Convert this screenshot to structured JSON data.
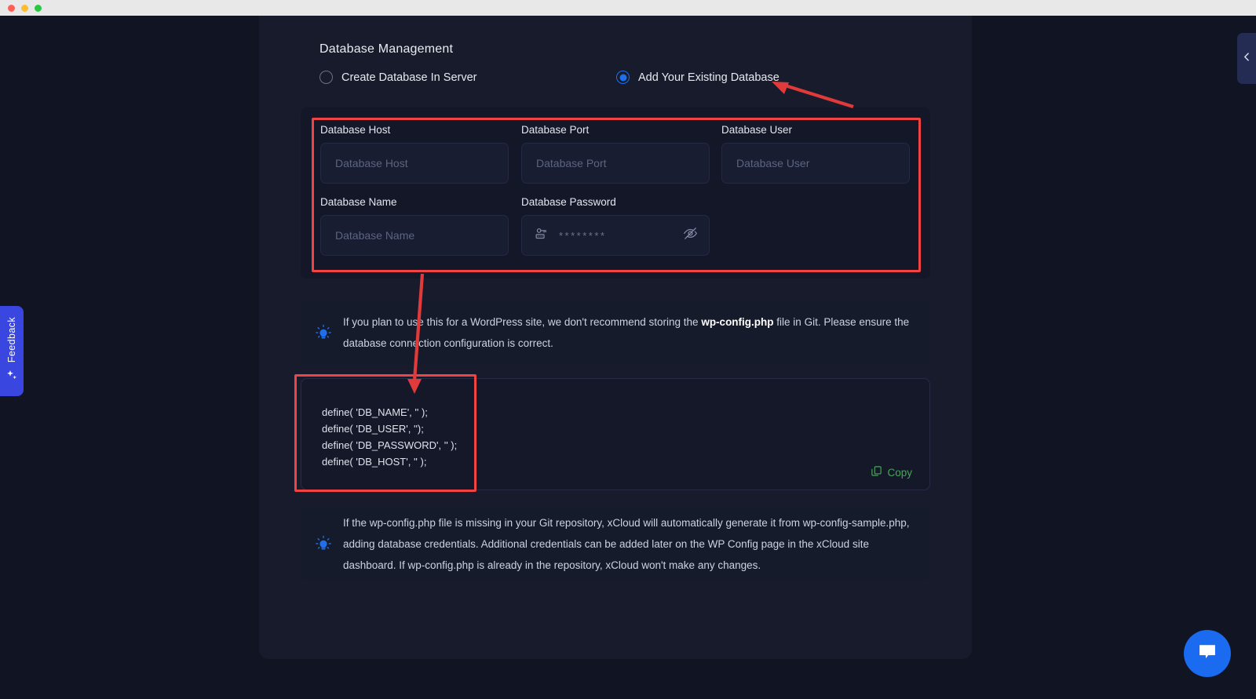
{
  "window": {
    "traffic_lights": [
      "close",
      "minimize",
      "maximize"
    ]
  },
  "section": {
    "title": "Database Management"
  },
  "radios": [
    {
      "id": "create",
      "label": "Create Database In Server",
      "selected": false
    },
    {
      "id": "existing",
      "label": "Add Your Existing Database",
      "selected": true
    }
  ],
  "fields": {
    "host": {
      "label": "Database Host",
      "placeholder": "Database Host",
      "value": ""
    },
    "port": {
      "label": "Database Port",
      "placeholder": "Database Port",
      "value": ""
    },
    "user": {
      "label": "Database User",
      "placeholder": "Database User",
      "value": ""
    },
    "name": {
      "label": "Database Name",
      "placeholder": "Database Name",
      "value": ""
    },
    "password": {
      "label": "Database Password",
      "masked_value": "********",
      "icon": "key-icon",
      "toggle_icon": "eye-off-icon"
    }
  },
  "notes": {
    "top": {
      "icon": "lightbulb-icon",
      "text_before": "If you plan to use this for a WordPress site, we don't recommend storing the ",
      "bold": "wp-config.php",
      "text_after": " file in Git. Please ensure the database connection configuration is correct."
    },
    "bottom": {
      "icon": "lightbulb-icon",
      "text": "If the wp-config.php file is missing in your Git repository, xCloud will automatically generate it from wp-config-sample.php, adding database credentials. Additional credentials can be added later on the WP Config page in the xCloud site dashboard. If wp-config.php is already in the repository, xCloud won't make any changes."
    }
  },
  "code_block": {
    "lines": [
      "define( 'DB_NAME', '' );",
      "define( 'DB_USER', '');",
      "define( 'DB_PASSWORD', '' );",
      "define( 'DB_HOST', '' );"
    ],
    "copy_label": "Copy",
    "copy_icon": "copy-icon",
    "copy_color": "#46a758"
  },
  "feedback": {
    "label": "Feedback",
    "icon": "sparkles-icon",
    "color": "#3a46e0"
  },
  "panel_toggle": {
    "icon": "chevron-left-icon"
  },
  "chat": {
    "icon": "chat-bubble-icon",
    "color": "#1a6bf0"
  },
  "annotations": {
    "color": "#f04444",
    "boxes": [
      "credentials-fields",
      "code-defines"
    ],
    "arrows": [
      "to-existing-database-radio",
      "to-code-block"
    ]
  }
}
